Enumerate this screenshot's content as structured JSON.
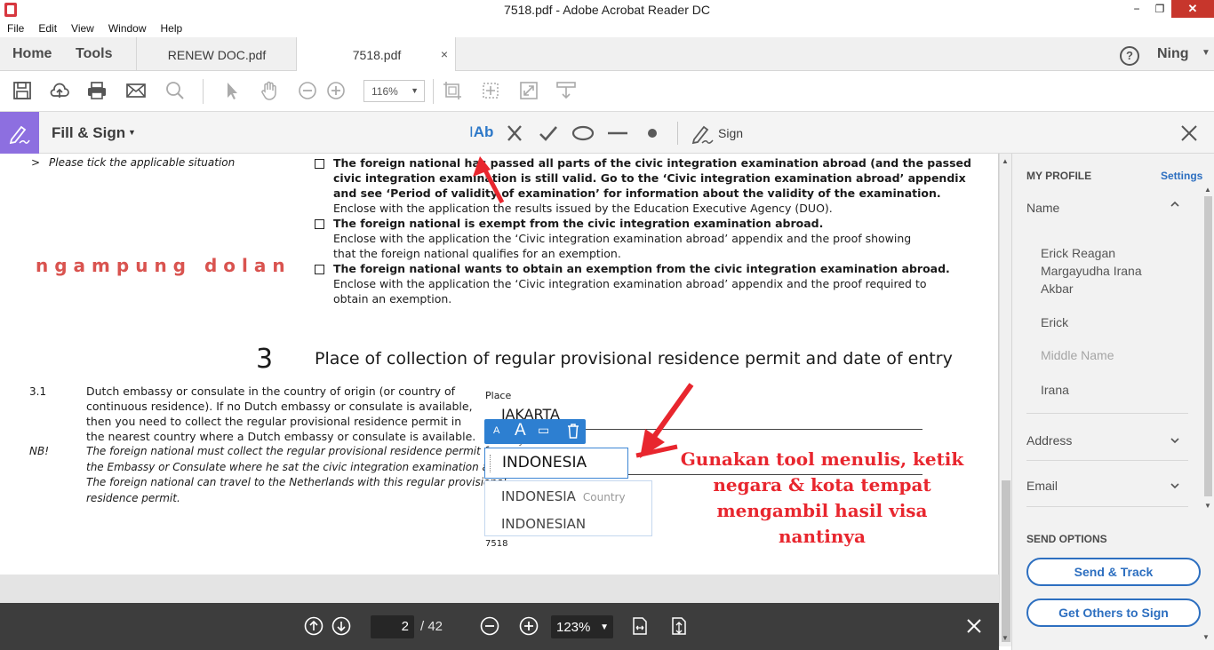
{
  "window": {
    "title": "7518.pdf - Adobe Acrobat Reader DC",
    "minimize": "−",
    "maximize": "❐",
    "close": "✕"
  },
  "menu": [
    "File",
    "Edit",
    "View",
    "Window",
    "Help"
  ],
  "tabs": {
    "home": "Home",
    "tools": "Tools",
    "documents": [
      {
        "label": "RENEW DOC.pdf"
      },
      {
        "label": "7518.pdf",
        "close": "×"
      }
    ],
    "help": "?",
    "user": "Ning"
  },
  "toolbar": {
    "zoom": "116%",
    "icons": [
      "save-icon",
      "upload-icon",
      "print-icon",
      "email-icon",
      "search-icon",
      "select-icon",
      "hand-icon",
      "zoom-out-icon",
      "zoom-in-icon",
      "crop-icon",
      "fit-icon",
      "fullscreen-icon",
      "scroll-icon"
    ]
  },
  "fill_sign": {
    "title": "Fill & Sign",
    "text_tool": "Ab",
    "sign_label": "Sign"
  },
  "document": {
    "tick_instruction": "Please tick the applicable situation",
    "tick_marker": ">",
    "option1_bold": [
      "The foreign national has passed all parts of the civic integration examination abroad (and the passed",
      "civic integration examination is still valid. Go to the ‘Civic integration examination abroad’ appendix",
      "and see ‘Period of validity of examination’ for information about the validity of the examination."
    ],
    "option1_text": "Enclose with the application the results issued by the Education Executive Agency (DUO).",
    "option2_bold": "The foreign national is exempt from the civic integration examination abroad.",
    "option2_text": [
      "Enclose with the application the ‘Civic integration examination abroad’ appendix and the proof showing",
      "that the foreign national qualifies for an exemption."
    ],
    "option3_bold": "The foreign national wants to obtain an exemption from the civic integration examination abroad.",
    "option3_text": [
      "Enclose with the application the ‘Civic integration examination abroad’ appendix and the proof required to",
      "obtain an exemption."
    ],
    "watermark": "ngampung dolan",
    "section_number": "3",
    "section_title": "Place of collection of regular provisional residence permit and date of entry",
    "item_number": "3.1",
    "item_text": [
      "Dutch embassy or consulate in the country of origin (or country of",
      "continuous residence). If no Dutch embassy or consulate is available,",
      "then you need to collect the regular provisional residence permit in",
      "the nearest country where a Dutch embassy or consulate is available."
    ],
    "nb_label": "NB!",
    "nb_text": [
      "The foreign national must collect the regular provisional residence permit from",
      "the Embassy or Consulate where he sat the civic integration examination abroad.",
      "The foreign national can travel to the Netherlands with this regular provisional",
      "residence permit."
    ],
    "place_label": "Place",
    "place_value": "JAKARTA",
    "country_label": "Country",
    "field_input": "INDONESIA",
    "suggestions": [
      {
        "text": "INDONESIA",
        "tag": "Country"
      },
      {
        "text": "INDONESIAN",
        "tag": ""
      }
    ],
    "footer_code": "7518",
    "annotation": [
      "Gunakan tool menulis, ketik",
      "negara & kota tempat",
      "mengambil hasil visa",
      "nantinya"
    ],
    "annotation_color": "#e8262e"
  },
  "navigation": {
    "page": "2",
    "total": "/ 42",
    "zoom": "123%"
  },
  "profile": {
    "heading": "MY PROFILE",
    "settings": "Settings",
    "name_label": "Name",
    "full_name": [
      "Erick Reagan",
      "Margayudha Irana",
      "Akbar"
    ],
    "first_name": "Erick",
    "middle_placeholder": "Middle Name",
    "last_name": "Irana",
    "address_label": "Address",
    "email_label": "Email",
    "send_heading": "SEND OPTIONS",
    "send_track": "Send & Track",
    "get_others": "Get Others to Sign"
  },
  "colors": {
    "accent": "#2d6fc0",
    "fill_sign_badge": "#8d6fe0",
    "close_red": "#c7362c"
  }
}
